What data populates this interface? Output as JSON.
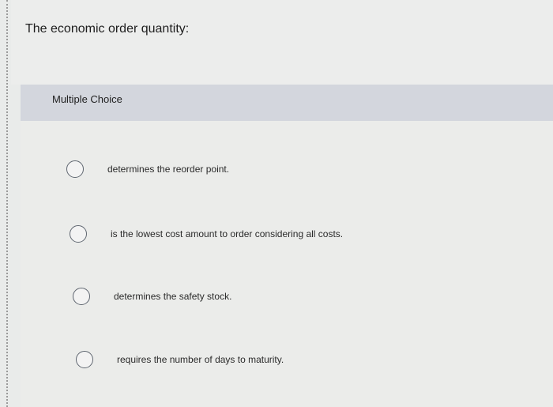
{
  "question": {
    "prompt": "The economic order quantity:",
    "type_label": "Multiple Choice"
  },
  "options": [
    {
      "label": "determines the reorder point."
    },
    {
      "label": "is the lowest cost amount to order considering all costs."
    },
    {
      "label": "determines the safety stock."
    },
    {
      "label": "requires the number of days to maturity."
    }
  ]
}
